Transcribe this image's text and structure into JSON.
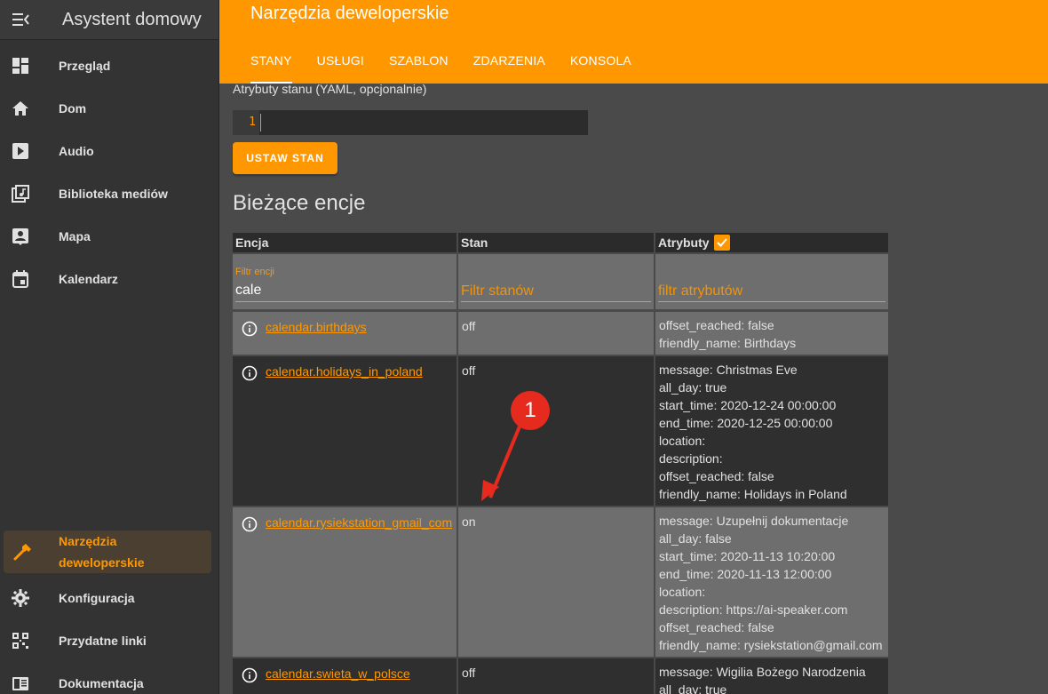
{
  "sidebar": {
    "title": "Asystent domowy",
    "items": [
      {
        "label": "Przegląd",
        "icon": "dashboard-icon"
      },
      {
        "label": "Dom",
        "icon": "home-icon"
      },
      {
        "label": "Audio",
        "icon": "play-box-icon"
      },
      {
        "label": "Biblioteka mediów",
        "icon": "music-library-icon"
      },
      {
        "label": "Mapa",
        "icon": "map-account-icon"
      },
      {
        "label": "Kalendarz",
        "icon": "calendar-icon"
      }
    ],
    "active": {
      "label_line1": "Narzędzia",
      "label_line2": "deweloperskie",
      "icon": "hammer-icon"
    },
    "bottom_items": [
      {
        "label": "Konfiguracja",
        "icon": "gear-icon"
      },
      {
        "label": "Przydatne linki",
        "icon": "qrcode-icon"
      },
      {
        "label": "Dokumentacja",
        "icon": "book-icon"
      }
    ]
  },
  "header": {
    "title": "Narzędzia deweloperskie",
    "tabs": [
      "STANY",
      "USŁUGI",
      "SZABLON",
      "ZDARZENIA",
      "KONSOLA"
    ]
  },
  "form": {
    "attr_label": "Atrybuty stanu (YAML, opcjonalnie)",
    "line_number": "1",
    "set_button": "USTAW STAN"
  },
  "entities": {
    "title": "Bieżące encje",
    "headers": {
      "entity": "Encja",
      "state": "Stan",
      "attributes": "Atrybuty"
    },
    "filters": {
      "entity_label": "Filtr encji",
      "entity_value": "cale",
      "state_placeholder": "Filtr stanów",
      "attr_placeholder": "filtr atrybutów"
    },
    "rows": [
      {
        "entity": "calendar.birthdays",
        "state": "off",
        "attributes": [
          "offset_reached: false",
          "friendly_name: Birthdays"
        ]
      },
      {
        "entity": "calendar.holidays_in_poland",
        "state": "off",
        "attributes": [
          "message: Christmas Eve",
          "all_day: true",
          "start_time: 2020-12-24 00:00:00",
          "end_time: 2020-12-25 00:00:00",
          "location:",
          "description:",
          "offset_reached: false",
          "friendly_name: Holidays in Poland"
        ]
      },
      {
        "entity": "calendar.rysiekstation_gmail_com",
        "state": "on",
        "attributes": [
          "message: Uzupełnij dokumentacje",
          "all_day: false",
          "start_time: 2020-11-13 10:20:00",
          "end_time: 2020-11-13 12:00:00",
          "location:",
          "description: https://ai-speaker.com",
          "offset_reached: false",
          "friendly_name: rysiekstation@gmail.com"
        ]
      },
      {
        "entity": "calendar.swieta_w_polsce",
        "state": "off",
        "attributes": [
          "message: Wigilia Bożego Narodzenia",
          "all_day: true"
        ]
      }
    ]
  },
  "annotation": {
    "number": "1"
  },
  "colors": {
    "accent": "#ff9800",
    "annotation": "#e62b1e"
  }
}
